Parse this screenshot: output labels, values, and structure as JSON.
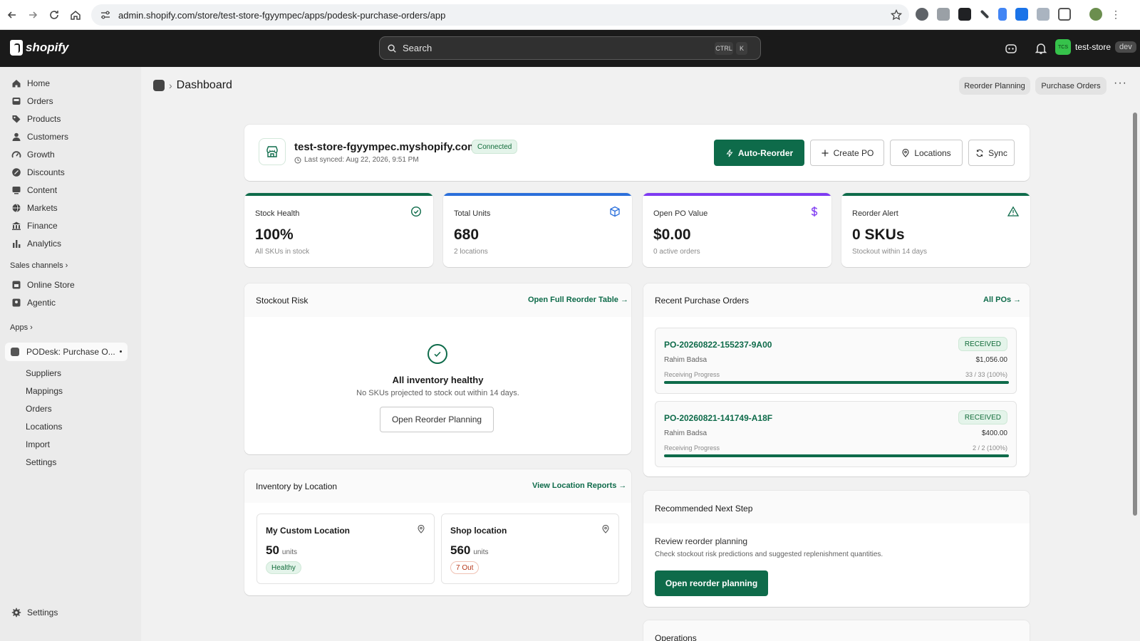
{
  "browser": {
    "url": "admin.shopify.com/store/test-store-fgyympec/apps/podesk-purchase-orders/app"
  },
  "topbar": {
    "logo_text": "shopify",
    "search_placeholder": "Search",
    "kbd_ctrl": "CTRL",
    "kbd_k": "K",
    "store_initials": "TCS",
    "store_name": "test-store",
    "store_badge": "dev"
  },
  "sidebar": {
    "items": [
      {
        "label": "Home",
        "icon": "home-icon"
      },
      {
        "label": "Orders",
        "icon": "inbox-icon"
      },
      {
        "label": "Products",
        "icon": "tag-icon"
      },
      {
        "label": "Customers",
        "icon": "person-icon"
      },
      {
        "label": "Growth",
        "icon": "gauge-icon"
      },
      {
        "label": "Discounts",
        "icon": "discount-icon"
      },
      {
        "label": "Content",
        "icon": "content-icon"
      },
      {
        "label": "Markets",
        "icon": "globe-icon"
      },
      {
        "label": "Finance",
        "icon": "bank-icon"
      },
      {
        "label": "Analytics",
        "icon": "bar-chart-icon"
      }
    ],
    "sales_channels_label": "Sales channels",
    "channels": [
      {
        "label": "Online Store",
        "icon": "store-icon"
      },
      {
        "label": "Agentic",
        "icon": "agent-icon"
      }
    ],
    "apps_label": "Apps",
    "app_name": "PODesk: Purchase O...",
    "app_subitems": [
      "Suppliers",
      "Mappings",
      "Orders",
      "Locations",
      "Import",
      "Settings"
    ],
    "settings_label": "Settings"
  },
  "header": {
    "title": "Dashboard",
    "btn_reorder_planning": "Reorder Planning",
    "btn_purchase_orders": "Purchase Orders",
    "more": "···"
  },
  "store": {
    "domain": "test-store-fgyympec.myshopify.com",
    "status": "Connected",
    "last_synced": "Last synced: Aug 22, 2026, 9:51 PM",
    "btn_auto_reorder": "Auto-Reorder",
    "btn_create_po": "Create PO",
    "btn_locations": "Locations",
    "btn_sync": "Sync"
  },
  "stats": [
    {
      "label": "Stock Health",
      "value": "100%",
      "sub": "All SKUs in stock",
      "color": "#0e6b4a",
      "icon": "check-circle-icon"
    },
    {
      "label": "Total Units",
      "value": "680",
      "sub": "2 locations",
      "color": "#2a6fdb",
      "icon": "box-icon"
    },
    {
      "label": "Open PO Value",
      "value": "$0.00",
      "sub": "0 active orders",
      "color": "#7e3af2",
      "icon": "dollar-icon"
    },
    {
      "label": "Reorder Alert",
      "value": "0 SKUs",
      "sub": "Stockout within 14 days",
      "color": "#0e6b4a",
      "icon": "alert-triangle-icon"
    }
  ],
  "stockout": {
    "title": "Stockout Risk",
    "link": "Open Full Reorder Table",
    "healthy_title": "All inventory healthy",
    "healthy_sub": "No SKUs projected to stock out within 14 days.",
    "button": "Open Reorder Planning"
  },
  "inventory": {
    "title": "Inventory by Location",
    "link": "View Location Reports",
    "units_label": "units",
    "locations": [
      {
        "name": "My Custom Location",
        "units": "50",
        "badge": "Healthy"
      },
      {
        "name": "Shop location",
        "units": "560",
        "badge": "7 Out"
      }
    ]
  },
  "recent_pos": {
    "title": "Recent Purchase Orders",
    "link": "All POs",
    "progress_label": "Receiving Progress",
    "items": [
      {
        "id": "PO-20260822-155237-9A00",
        "status": "RECEIVED",
        "vendor": "Rahim Badsa",
        "amount": "$1,056.00",
        "progress": "33 / 33 (100%)",
        "progress_fraction": 1.0
      },
      {
        "id": "PO-20260821-141749-A18F",
        "status": "RECEIVED",
        "vendor": "Rahim Badsa",
        "amount": "$400.00",
        "progress": "2 / 2 (100%)",
        "progress_fraction": 1.0
      }
    ]
  },
  "next_step": {
    "title": "Recommended Next Step",
    "heading": "Review reorder planning",
    "desc": "Check stockout risk predictions and suggested replenishment quantities.",
    "button": "Open reorder planning"
  },
  "operations": {
    "title": "Operations"
  }
}
